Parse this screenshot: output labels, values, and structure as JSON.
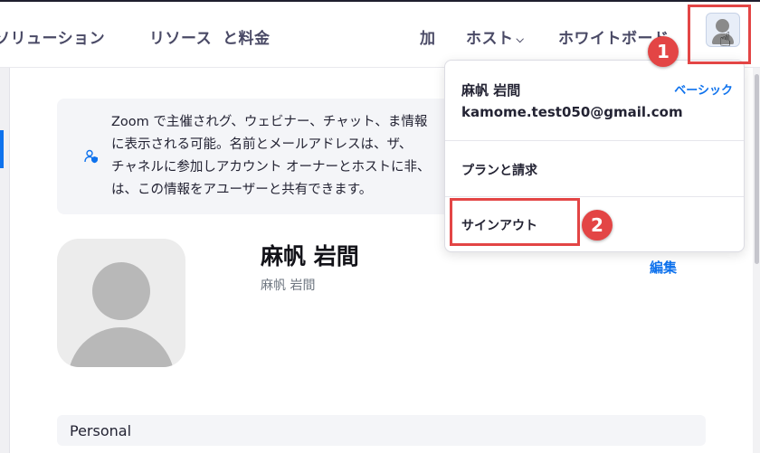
{
  "nav": {
    "items": [
      {
        "label": "ソリューション"
      },
      {
        "label": "リソース"
      },
      {
        "label": "と料金"
      },
      {
        "label": "加"
      },
      {
        "label": "ホスト",
        "chevron": "⌵"
      },
      {
        "label": "ホワイトボード"
      }
    ]
  },
  "info_box": {
    "icon": "user-shield-icon",
    "lines": [
      "Zoom で主催されグ、ウェビナー、チャット、ま情報",
      "に表示される可能。名前とメールアドレスは、ザ、",
      "チャネルに参加しアカウント オーナーとホストに非、",
      "は、この情報をアユーザーと共有できます。"
    ]
  },
  "profile": {
    "name": "麻帆 岩間",
    "sub_name": "麻帆 岩間",
    "edit_label": "編集"
  },
  "section": {
    "label": "Personal"
  },
  "dropdown": {
    "name": "麻帆 岩間",
    "plan": "ベーシック",
    "email": "kamome.test050@gmail.com",
    "plan_billing": "プランと請求",
    "sign_out": "サインアウト"
  },
  "annotations": {
    "step1": "1",
    "step2": "2",
    "highlight_color": "#e34545"
  },
  "colors": {
    "accent": "#0e72ed",
    "text": "#232333",
    "panel_bg": "#f4f5f8"
  }
}
